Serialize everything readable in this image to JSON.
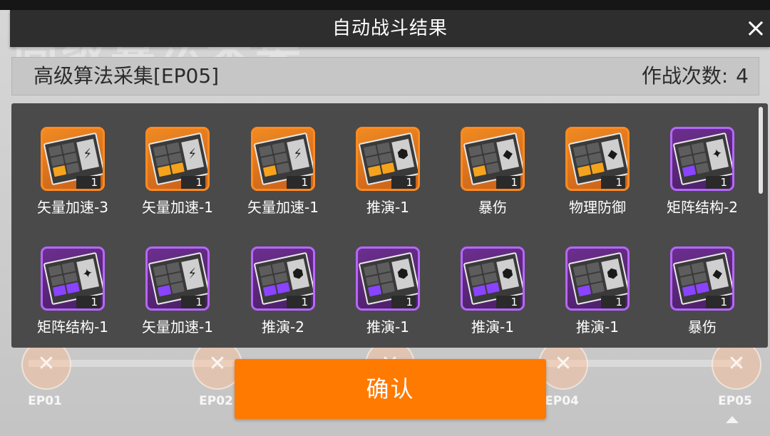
{
  "background": {
    "stage_title": "高级算法采集",
    "nodes": [
      {
        "label": "EP01",
        "icon": "crossed-swords-icon"
      },
      {
        "label": "EP02",
        "icon": "crossed-swords-icon"
      },
      {
        "label": "",
        "icon": "crossed-swords-icon"
      },
      {
        "label": "EP04",
        "icon": "crossed-swords-icon"
      },
      {
        "label": "EP05",
        "icon": "crossed-swords-icon"
      }
    ]
  },
  "dialog": {
    "title": "自动战斗结果",
    "close_icon": "×"
  },
  "stage": {
    "name": "高级算法采集[EP05]",
    "battle_count_label": "作战次数:",
    "battle_count": "4"
  },
  "rewards": [
    {
      "name": "矢量加速-3",
      "count": "1",
      "rarity": "orange",
      "glyph": "⚡"
    },
    {
      "name": "矢量加速-1",
      "count": "1",
      "rarity": "orange",
      "glyph": "⚡"
    },
    {
      "name": "矢量加速-1",
      "count": "1",
      "rarity": "orange",
      "glyph": "⚡"
    },
    {
      "name": "推演-1",
      "count": "1",
      "rarity": "orange",
      "glyph": "⬢"
    },
    {
      "name": "暴伤",
      "count": "1",
      "rarity": "orange",
      "glyph": "◆"
    },
    {
      "name": "物理防御",
      "count": "1",
      "rarity": "orange",
      "glyph": "◆"
    },
    {
      "name": "矩阵结构-2",
      "count": "1",
      "rarity": "purple",
      "glyph": "✦"
    },
    {
      "name": "矩阵结构-1",
      "count": "1",
      "rarity": "purple",
      "glyph": "✦"
    },
    {
      "name": "矢量加速-1",
      "count": "1",
      "rarity": "purple",
      "glyph": "⚡"
    },
    {
      "name": "推演-2",
      "count": "1",
      "rarity": "purple",
      "glyph": "⬢"
    },
    {
      "name": "推演-1",
      "count": "1",
      "rarity": "purple",
      "glyph": "⬢"
    },
    {
      "name": "推演-1",
      "count": "1",
      "rarity": "purple",
      "glyph": "⬢"
    },
    {
      "name": "推演-1",
      "count": "1",
      "rarity": "purple",
      "glyph": "⬢"
    },
    {
      "name": "暴伤",
      "count": "1",
      "rarity": "purple",
      "glyph": "◆"
    }
  ],
  "confirm_button": {
    "label": "确认"
  },
  "colors": {
    "accent_orange": "#ff7a00",
    "rarity_orange": "#ff8a1f",
    "rarity_purple": "#b766ff",
    "panel": "#4a4a4a"
  }
}
